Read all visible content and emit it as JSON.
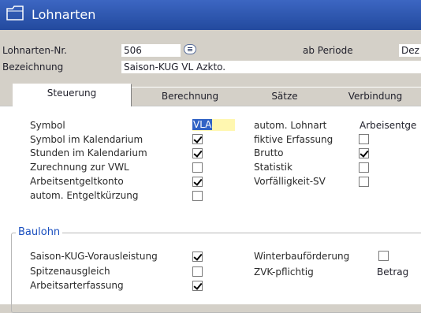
{
  "window": {
    "title": "Lohnarten"
  },
  "header": {
    "nr_label": "Lohnarten-Nr.",
    "nr_value": "506",
    "period_label": "ab Periode",
    "period_value": "Dez",
    "bez_label": "Bezeichnung",
    "bez_value": "Saison-KUG VL Azkto."
  },
  "tabs": [
    {
      "label": "Steuerung",
      "active": true
    },
    {
      "label": "Berechnung",
      "active": false
    },
    {
      "label": "Sätze",
      "active": false
    },
    {
      "label": "Verbindung",
      "active": false
    }
  ],
  "left_rows": [
    {
      "label": "Symbol",
      "kind": "text",
      "value": "VLA"
    },
    {
      "label": "Symbol im Kalendarium",
      "kind": "check",
      "checked": true
    },
    {
      "label": "Stunden im Kalendarium",
      "kind": "check",
      "checked": true
    },
    {
      "label": "Zurechnung zur VWL",
      "kind": "check",
      "checked": false
    },
    {
      "label": "Arbeitsentgeltkonto",
      "kind": "check",
      "checked": true
    },
    {
      "label": "autom. Entgeltkürzung",
      "kind": "check",
      "checked": false
    }
  ],
  "right_rows": [
    {
      "label": "autom. Lohnart",
      "kind": "text",
      "value": "Arbeisentge"
    },
    {
      "label": "fiktive Erfassung",
      "kind": "check",
      "checked": false
    },
    {
      "label": "Brutto",
      "kind": "check",
      "checked": true
    },
    {
      "label": "Statistik",
      "kind": "check",
      "checked": false
    },
    {
      "label": "Vorfälligkeit-SV",
      "kind": "check",
      "checked": false
    }
  ],
  "baulohn": {
    "title": "Baulohn",
    "left": [
      {
        "label": "Saison-KUG-Vorausleistung",
        "checked": true
      },
      {
        "label": "Spitzenausgleich",
        "checked": false
      },
      {
        "label": "Arbeitsarterfassung",
        "checked": true
      }
    ],
    "right": [
      {
        "label": "Winterbauförderung",
        "kind": "check",
        "checked": false
      },
      {
        "label": "ZVK-pflichtig",
        "kind": "text",
        "value": "Betrag"
      }
    ]
  }
}
